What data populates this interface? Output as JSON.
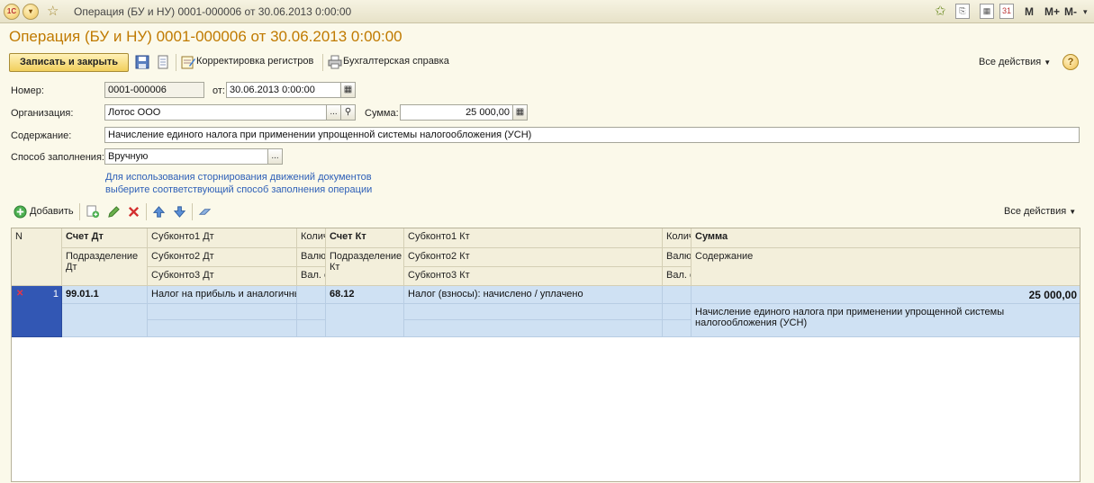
{
  "window": {
    "title": "Операция (БУ и НУ) 0001-000006 от 30.06.2013 0:00:00",
    "right_buttons": [
      "M",
      "M+",
      "M-"
    ],
    "logo": "1С"
  },
  "document": {
    "title": "Операция (БУ и НУ) 0001-000006 от 30.06.2013 0:00:00"
  },
  "toolbar": {
    "save_close": "Записать и закрыть",
    "corrections": "Корректировка регистров",
    "accounting_note": "Бухгалтерская справка",
    "all_actions": "Все действия",
    "help": "?"
  },
  "form": {
    "number_label": "Номер:",
    "number_value": "0001-000006",
    "date_label": "от:",
    "date_value": "30.06.2013  0:00:00",
    "org_label": "Организация:",
    "org_value": "Лотос ООО",
    "org_select_btn": "...",
    "sum_label": "Сумма:",
    "sum_value": "25 000,00",
    "content_label": "Содержание:",
    "content_value": "Начисление единого налога при применении упрощенной системы налогообложения (УСН)",
    "fill_label": "Способ заполнения:",
    "fill_value": "Вручную",
    "fill_select_btn": "...",
    "hint_line1": "Для использования сторнирования движений документов",
    "hint_line2": "выберите соответствующий способ заполнения операции"
  },
  "table_toolbar": {
    "add": "Добавить",
    "all_actions": "Все действия"
  },
  "table": {
    "headers": {
      "n": "N",
      "dt_account": "Счет Дт",
      "dt_division": "Подразделение Дт",
      "subconto1_dt": "Субконто1 Дт",
      "subconto2_dt": "Субконто2 Дт",
      "subconto3_dt": "Субконто3 Дт",
      "qty_dt": "Количество Дт",
      "cur_dt": "Валюта Дт",
      "cur_sum_dt": "Вал. сумма Дт",
      "kt_account": "Счет Кт",
      "kt_division": "Подразделение Кт",
      "subconto1_kt": "Субконто1 Кт",
      "subconto2_kt": "Субконто2 Кт",
      "subconto3_kt": "Субконто3 Кт",
      "qty_kt": "Количество Кт",
      "cur_kt": "Валюта Кт",
      "cur_sum_kt": "Вал. сумма Кт",
      "sum": "Сумма",
      "content": "Содержание"
    },
    "rows": [
      {
        "n": "1",
        "dt_account": "99.01.1",
        "subconto1_dt": "Налог на прибыль и аналогичные платежи",
        "kt_account": "68.12",
        "subconto1_kt": "Налог (взносы): начислено / уплачено",
        "sum": "25 000,00",
        "content": "Начисление единого налога при применении упрощенной системы налогообложения (УСН)"
      }
    ]
  },
  "colors": {
    "title": "#c07a00",
    "selection": "#cfe1f3",
    "row_marker": "#3257b4",
    "hint": "#2d5fb7"
  }
}
